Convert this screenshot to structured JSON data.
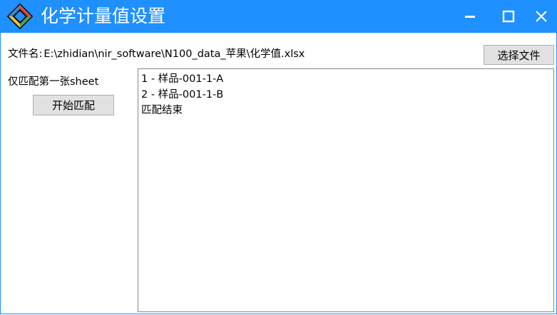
{
  "window": {
    "title": "化学计量值设置",
    "icon": "app-logo-icon",
    "controls": {
      "minimize": "minimize-icon",
      "maximize": "maximize-icon",
      "close": "close-icon"
    }
  },
  "file": {
    "label": "文件名:",
    "path": "E:\\zhidian\\nir_software\\N100_data_苹果\\化学值.xlsx",
    "choose_button": "选择文件"
  },
  "options": {
    "only_first_sheet_label": "仅匹配第一张sheet",
    "start_match_button": "开始匹配"
  },
  "results": {
    "lines": [
      "1 - 样品-001-1-A",
      "2 - 样品-001-1-B",
      "匹配结束"
    ]
  },
  "colors": {
    "titlebar": "#1e90ff",
    "button_bg": "#e1e1e1",
    "button_border": "#adadad",
    "textbox_border": "#828790"
  }
}
